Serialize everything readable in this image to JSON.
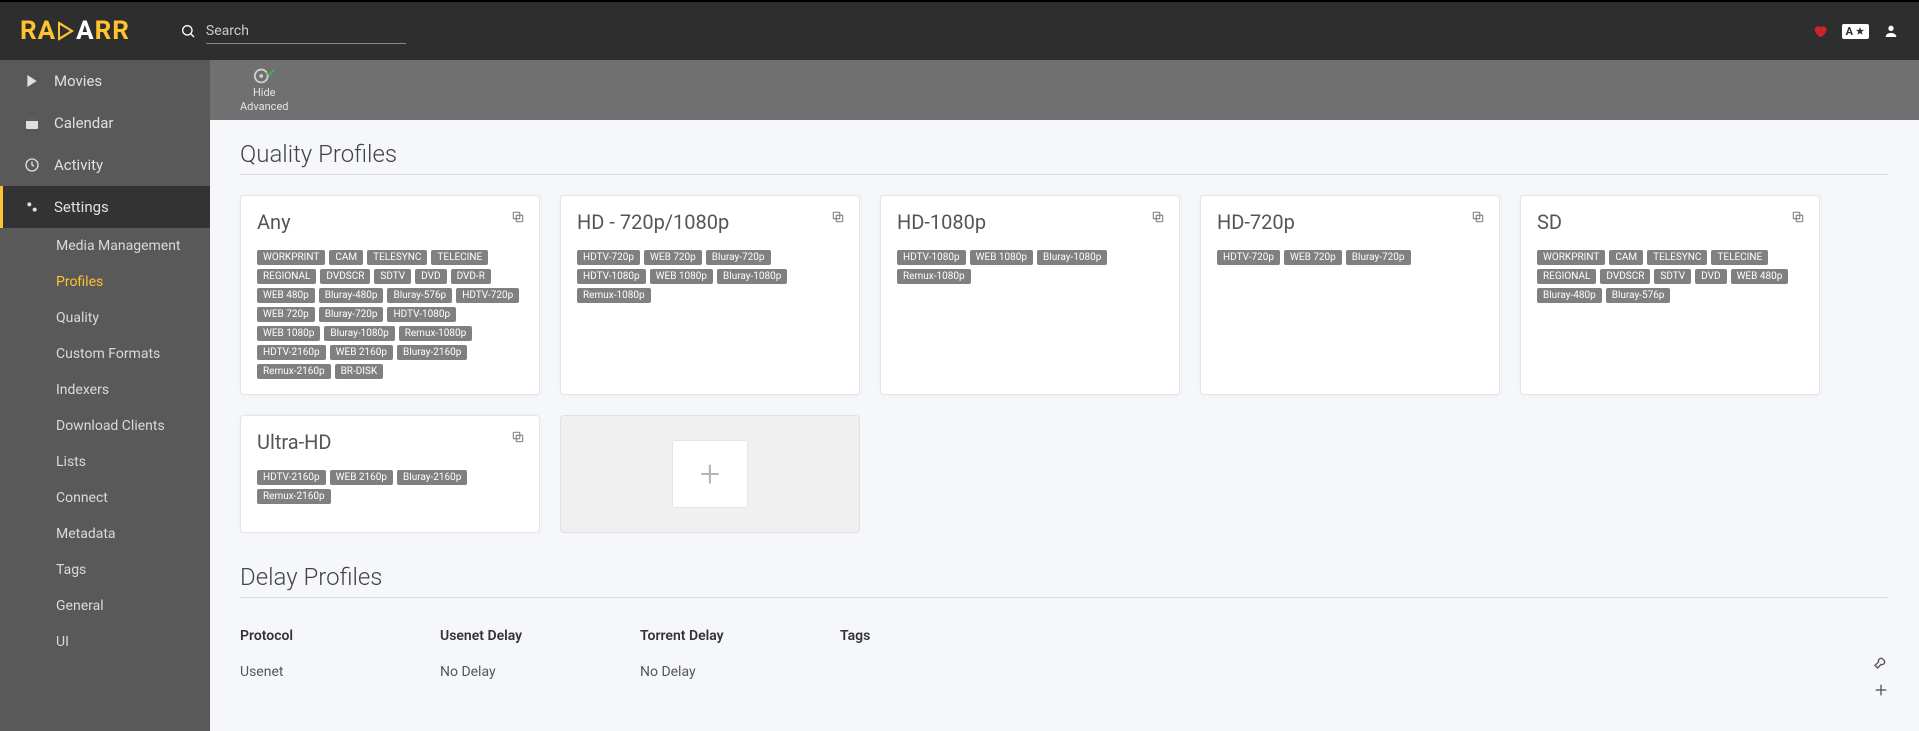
{
  "search": {
    "placeholder": "Search"
  },
  "sidebar": {
    "items": [
      {
        "label": "Movies"
      },
      {
        "label": "Calendar"
      },
      {
        "label": "Activity"
      },
      {
        "label": "Settings"
      }
    ],
    "sub": [
      {
        "label": "Media Management"
      },
      {
        "label": "Profiles"
      },
      {
        "label": "Quality"
      },
      {
        "label": "Custom Formats"
      },
      {
        "label": "Indexers"
      },
      {
        "label": "Download Clients"
      },
      {
        "label": "Lists"
      },
      {
        "label": "Connect"
      },
      {
        "label": "Metadata"
      },
      {
        "label": "Tags"
      },
      {
        "label": "General"
      },
      {
        "label": "UI"
      }
    ]
  },
  "toolbar": {
    "hide": "Hide",
    "advanced": "Advanced"
  },
  "sections": {
    "quality_profiles": "Quality Profiles",
    "delay_profiles": "Delay Profiles"
  },
  "profiles": [
    {
      "name": "Any",
      "tags": [
        "WORKPRINT",
        "CAM",
        "TELESYNC",
        "TELECINE",
        "REGIONAL",
        "DVDSCR",
        "SDTV",
        "DVD",
        "DVD-R",
        "WEB 480p",
        "Bluray-480p",
        "Bluray-576p",
        "HDTV-720p",
        "WEB 720p",
        "Bluray-720p",
        "HDTV-1080p",
        "WEB 1080p",
        "Bluray-1080p",
        "Remux-1080p",
        "HDTV-2160p",
        "WEB 2160p",
        "Bluray-2160p",
        "Remux-2160p",
        "BR-DISK"
      ]
    },
    {
      "name": "HD - 720p/1080p",
      "tags": [
        "HDTV-720p",
        "WEB 720p",
        "Bluray-720p",
        "HDTV-1080p",
        "WEB 1080p",
        "Bluray-1080p",
        "Remux-1080p"
      ]
    },
    {
      "name": "HD-1080p",
      "tags": [
        "HDTV-1080p",
        "WEB 1080p",
        "Bluray-1080p",
        "Remux-1080p"
      ]
    },
    {
      "name": "HD-720p",
      "tags": [
        "HDTV-720p",
        "WEB 720p",
        "Bluray-720p"
      ]
    },
    {
      "name": "SD",
      "tags": [
        "WORKPRINT",
        "CAM",
        "TELESYNC",
        "TELECINE",
        "REGIONAL",
        "DVDSCR",
        "SDTV",
        "DVD",
        "WEB 480p",
        "Bluray-480p",
        "Bluray-576p"
      ]
    },
    {
      "name": "Ultra-HD",
      "tags": [
        "HDTV-2160p",
        "WEB 2160p",
        "Bluray-2160p",
        "Remux-2160p"
      ]
    }
  ],
  "delay": {
    "headers": {
      "protocol": "Protocol",
      "usenet": "Usenet Delay",
      "torrent": "Torrent Delay",
      "tags": "Tags"
    },
    "rows": [
      {
        "protocol": "Usenet",
        "usenet": "No Delay",
        "torrent": "No Delay",
        "tags": ""
      }
    ]
  },
  "logo": {
    "pre": "RA",
    "post1": "A",
    "post2": "RR"
  },
  "translate_badge": "A"
}
